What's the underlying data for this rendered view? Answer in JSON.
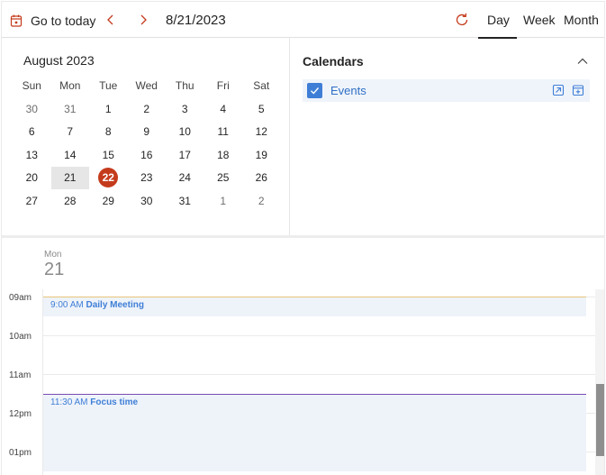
{
  "toolbar": {
    "go_to_today": "Go to today",
    "current_date": "8/21/2023",
    "views": {
      "day": "Day",
      "week": "Week",
      "month": "Month"
    },
    "active_view": "Day",
    "icons": [
      "calendar-today-icon",
      "chevron-left-icon",
      "chevron-right-icon",
      "refresh-icon"
    ]
  },
  "mini_calendar": {
    "month_label": "August 2023",
    "weekdays": [
      "Sun",
      "Mon",
      "Tue",
      "Wed",
      "Thu",
      "Fri",
      "Sat"
    ],
    "weeks": [
      [
        "30",
        "31",
        "1",
        "2",
        "3",
        "4",
        "5"
      ],
      [
        "6",
        "7",
        "8",
        "9",
        "10",
        "11",
        "12"
      ],
      [
        "13",
        "14",
        "15",
        "16",
        "17",
        "18",
        "19"
      ],
      [
        "20",
        "21",
        "22",
        "23",
        "24",
        "25",
        "26"
      ],
      [
        "27",
        "28",
        "29",
        "30",
        "31",
        "1",
        "2"
      ]
    ],
    "selected_day": "21",
    "today": "22"
  },
  "calendars_panel": {
    "title": "Calendars",
    "items": [
      {
        "name": "Events",
        "checked": true,
        "color": "#3f7ed6"
      }
    ]
  },
  "day_view": {
    "day_of_week": "Mon",
    "day_number": "21",
    "time_labels": [
      "09am",
      "10am",
      "11am",
      "12pm",
      "01pm"
    ],
    "events": [
      {
        "time": "9:00 AM",
        "title": "Daily Meeting",
        "accent": "#e8c37a"
      },
      {
        "time": "11:30 AM",
        "title": "Focus time",
        "accent": "#7a4bb3"
      }
    ]
  },
  "colors": {
    "accent_blue": "#3f7ed6",
    "today_red": "#c43b1c",
    "event_bg": "#eef3fa"
  }
}
